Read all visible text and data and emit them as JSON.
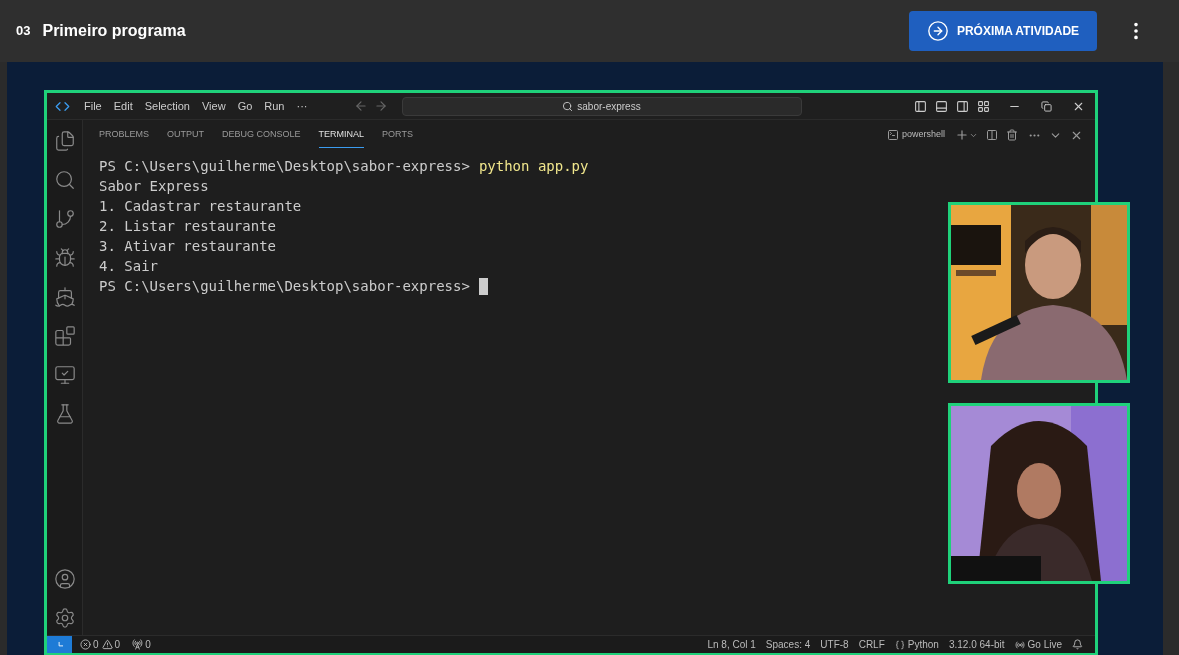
{
  "header": {
    "number": "03",
    "title": "Primeiro programa",
    "next_button": "PRÓXIMA ATIVIDADE"
  },
  "vscode": {
    "menu": [
      "File",
      "Edit",
      "Selection",
      "View",
      "Go",
      "Run"
    ],
    "menu_more": "···",
    "search": "sabor-express",
    "panel_tabs": [
      {
        "label": "PROBLEMS",
        "selected": false
      },
      {
        "label": "OUTPUT",
        "selected": false
      },
      {
        "label": "DEBUG CONSOLE",
        "selected": false
      },
      {
        "label": "TERMINAL",
        "selected": true
      },
      {
        "label": "PORTS",
        "selected": false
      }
    ],
    "terminal_name": "powershell",
    "terminal": [
      {
        "kind": "prompt",
        "prompt": "PS C:\\Users\\guilherme\\Desktop\\sabor-express>",
        "command": "python app.py",
        "cursor": false
      },
      {
        "kind": "output",
        "text": "Sabor Express"
      },
      {
        "kind": "output",
        "text": "1. Cadastrar restaurante"
      },
      {
        "kind": "output",
        "text": "2. Listar restaurante"
      },
      {
        "kind": "output",
        "text": "3. Ativar restaurante"
      },
      {
        "kind": "output",
        "text": "4. Sair"
      },
      {
        "kind": "prompt",
        "prompt": "PS C:\\Users\\guilherme\\Desktop\\sabor-express>",
        "cursor": true
      }
    ],
    "status_bar": {
      "errors": "0",
      "warnings": "0",
      "ports": "0",
      "items": [
        {
          "kind": "text",
          "text": "Ln 8, Col 1"
        },
        {
          "kind": "text",
          "text": "Spaces: 4"
        },
        {
          "kind": "text",
          "text": "UTF-8"
        },
        {
          "kind": "text",
          "text": "CRLF"
        },
        {
          "kind": "language",
          "text": "Python"
        },
        {
          "kind": "text",
          "text": "3.12.0 64-bit"
        },
        {
          "kind": "live",
          "text": "Go Live"
        }
      ]
    }
  }
}
